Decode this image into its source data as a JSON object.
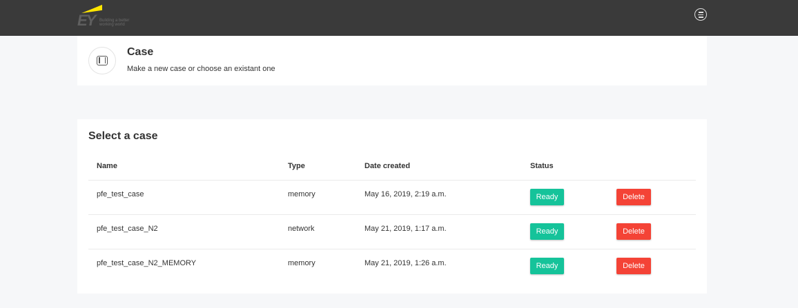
{
  "topbar": {
    "logo_text": "EY",
    "logo_tagline": "Building a better working world",
    "menu_icon": "menu-circle-icon"
  },
  "header": {
    "icon": "case-icon",
    "title": "Case",
    "subtitle": "Make a new case or choose an existant one"
  },
  "cases": {
    "title": "Select a case",
    "columns": [
      "Name",
      "Type",
      "Date created",
      "Status"
    ],
    "rows": [
      {
        "name": "pfe_test_case",
        "type": "memory",
        "date": "May 16, 2019, 2:19 a.m.",
        "status": "Ready",
        "delete": "Delete"
      },
      {
        "name": "pfe_test_case_N2",
        "type": "network",
        "date": "May 21, 2019, 1:17 a.m.",
        "status": "Ready",
        "delete": "Delete"
      },
      {
        "name": "pfe_test_case_N2_MEMORY",
        "type": "memory",
        "date": "May 21, 2019, 1:26 a.m.",
        "status": "Ready",
        "delete": "Delete"
      }
    ]
  },
  "colors": {
    "topbar": "#3a3a3a",
    "ready": "#15c39a",
    "delete": "#f44336",
    "brand_yellow": "#ffe600"
  }
}
